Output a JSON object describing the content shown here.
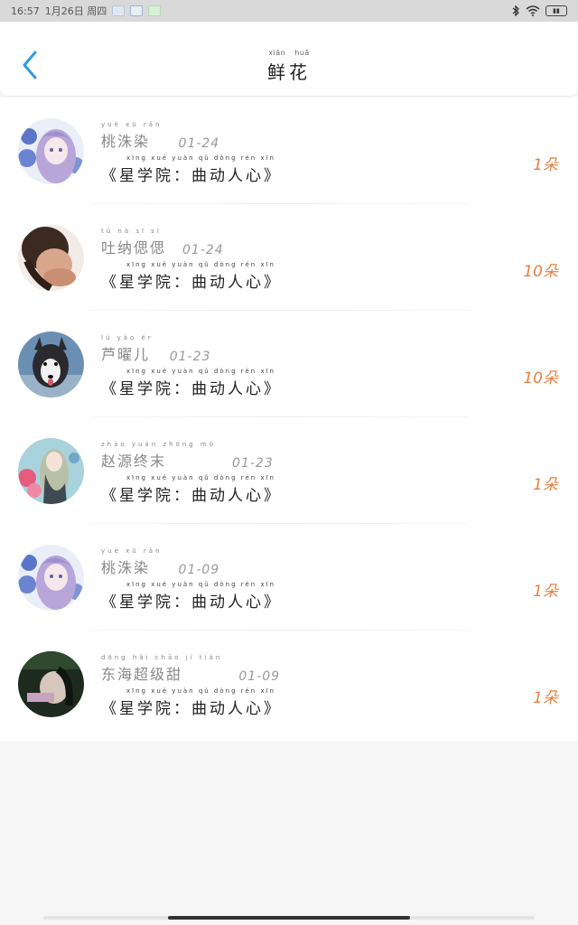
{
  "status": {
    "time": "16:57",
    "date": "1月26日 周四"
  },
  "header": {
    "title": "鲜花",
    "title_pinyin": [
      "xiān",
      "huā"
    ]
  },
  "items": [
    {
      "name": "桃洙染",
      "name_pinyin": "yuè  xū  rǎn",
      "date": "01-24",
      "book": "《星学院：曲动人心》",
      "book_pinyin": "xīng xué yuàn   qǔ dòng rén xīn",
      "amount": "1朵",
      "avatar": "anime-purple-hair"
    },
    {
      "name": "吐纳偲偲",
      "name_pinyin": "tǔ  nà  sī  sī",
      "date": "01-24",
      "book": "《星学院：曲动人心》",
      "book_pinyin": "xīng xué yuàn   qǔ dòng rén xīn",
      "amount": "10朵",
      "avatar": "photo-person"
    },
    {
      "name": "芦曜儿",
      "name_pinyin": "lú  yào  ér",
      "date": "01-23",
      "book": "《星学院：曲动人心》",
      "book_pinyin": "xīng xué yuàn   qǔ dòng rén xīn",
      "amount": "10朵",
      "avatar": "husky-dog"
    },
    {
      "name": "赵源终末",
      "name_pinyin": "zhào yuán zhōng mò",
      "date": "01-23",
      "book": "《星学院：曲动人心》",
      "book_pinyin": "xīng xué yuàn   qǔ dòng rén xīn",
      "amount": "1朵",
      "avatar": "anime-flowers"
    },
    {
      "name": "桃洙染",
      "name_pinyin": "yuè  xū  rǎn",
      "date": "01-09",
      "book": "《星学院：曲动人心》",
      "book_pinyin": "xīng xué yuàn   qǔ dòng rén xīn",
      "amount": "1朵",
      "avatar": "anime-purple-hair"
    },
    {
      "name": "东海超级甜",
      "name_pinyin": "dōng hǎi chāo jí tián",
      "date": "01-09",
      "book": "《星学院：曲动人心》",
      "book_pinyin": "xīng xué yuàn   qǔ dòng rén xīn",
      "amount": "1朵",
      "avatar": "dark-photo"
    }
  ],
  "colors": {
    "accent_blue": "#2e9be6",
    "amount_orange": "#e87f3f"
  },
  "icons": {
    "back": "chevron-left-icon",
    "bluetooth": "bluetooth-icon",
    "wifi": "wifi-icon",
    "battery": "battery-icon"
  }
}
